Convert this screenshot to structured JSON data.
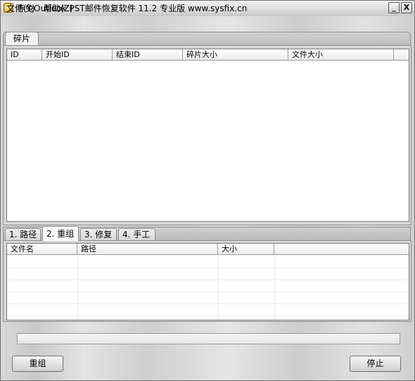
{
  "window": {
    "title": "赤兔Outlook PST邮件恢复软件 11.2 专业版 www.sysfix.cn"
  },
  "titlebar_buttons": {
    "minimize": "_",
    "close": "X"
  },
  "menu": [
    "文件(Y)",
    "帮助(Z)"
  ],
  "top_tabs": [
    "碎片"
  ],
  "fragments_table": {
    "columns": [
      "ID",
      "开始ID",
      "结束ID",
      "碎片大小",
      "文件大小"
    ],
    "rows": []
  },
  "bottom_tabs": [
    "1. 路径",
    "2. 重组",
    "3. 修复",
    "4. 手工"
  ],
  "active_bottom_tab": "2. 重组",
  "files_table": {
    "columns": [
      "文件名",
      "路径",
      "大小"
    ],
    "rows": []
  },
  "progress": {
    "value": 0
  },
  "buttons": {
    "rebuild": "重组",
    "stop": "停止"
  }
}
